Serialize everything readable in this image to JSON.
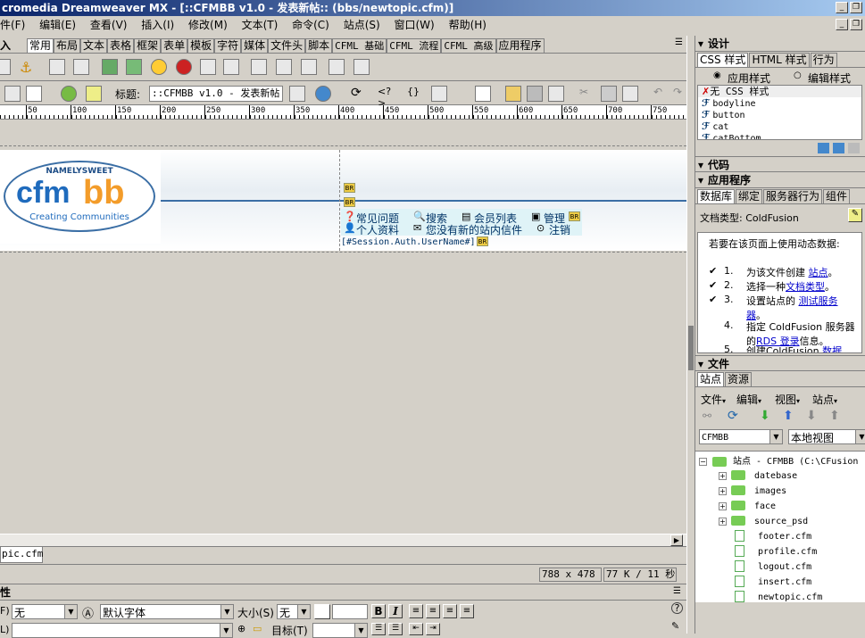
{
  "title": "cromedia Dreamweaver MX - [::CFMBB v1.0 - 发表新帖:: (bbs/newtopic.cfm)]",
  "menu": [
    "件(F)",
    "编辑(E)",
    "查看(V)",
    "插入(I)",
    "修改(M)",
    "文本(T)",
    "命令(C)",
    "站点(S)",
    "窗口(W)",
    "帮助(H)"
  ],
  "insert_label": "入",
  "insert_tabs": [
    "常用",
    "布局",
    "文本",
    "表格",
    "框架",
    "表单",
    "模板",
    "字符",
    "媒体",
    "文件头",
    "脚本",
    "CFML 基础",
    "CFML 流程",
    "CFML 高级",
    "应用程序"
  ],
  "doc_toolbar": {
    "title_label": "标题:",
    "title_value": "::CFMBB v1.0 - 发表新帖::"
  },
  "ruler_labels": [
    "50",
    "100",
    "150",
    "200",
    "250",
    "300",
    "350",
    "400",
    "450",
    "500",
    "550",
    "600",
    "650",
    "700",
    "750"
  ],
  "logo": {
    "top": "NAMELYSWEET",
    "left": "cfm",
    "right": "bb",
    "tag": "Creating Communities"
  },
  "nav": {
    "row1": [
      "常见问题",
      "搜索",
      "会员列表",
      "管理"
    ],
    "row2": [
      "个人资料",
      "您没有新的站内信件",
      "注销"
    ],
    "session": "[#Session.Auth.UserName#]"
  },
  "br_label": "BR",
  "doc_tab": "pic.cfm",
  "status": {
    "size": "788 x 478",
    "weight": "77 K / 11 秒"
  },
  "properties": {
    "title": "性",
    "format_label": "F)",
    "format_value": "无",
    "font_value": "默认字体",
    "size_label": "大小(S)",
    "size_value": "无",
    "link_label": "L)",
    "target_label": "目标(T)",
    "b": "B",
    "i": "I"
  },
  "design_panel": {
    "title": "设计",
    "tabs": [
      "CSS 样式",
      "HTML 样式",
      "行为"
    ],
    "radio1": "应用样式",
    "radio2": "编辑样式",
    "styles": [
      "无 CSS 样式",
      "bodyline",
      "button",
      "cat",
      "catBottom"
    ]
  },
  "code_panel": {
    "title": "代码"
  },
  "app_panel": {
    "title": "应用程序",
    "tabs": [
      "数据库",
      "绑定",
      "服务器行为",
      "组件"
    ],
    "doc_type": "文档类型: ColdFusion",
    "intro": "若要在该页面上使用动态数据:",
    "steps": [
      {
        "num": "1.",
        "text": "为该文件创建",
        "link": "站点",
        "tail": "。",
        "checked": true
      },
      {
        "num": "2.",
        "text": "选择一种",
        "link": "文档类型",
        "tail": "。",
        "checked": true
      },
      {
        "num": "3.",
        "text": "设置站点的",
        "link": "测试服务器",
        "tail": "。",
        "checked": true
      },
      {
        "num": "4.",
        "text": "指定 ColdFusion 服务器的",
        "link": "RDS 登录",
        "tail": "信息。",
        "checked": false
      },
      {
        "num": "5.",
        "text": "创建ColdFusion",
        "link": "数据",
        "tail": "",
        "checked": false
      }
    ]
  },
  "files_panel": {
    "title": "文件",
    "tabs": [
      "站点",
      "资源"
    ],
    "menus": [
      "文件",
      "编辑",
      "视图",
      "站点"
    ],
    "site": "CFMBB",
    "view": "本地视图",
    "root": "站点 - CFMBB (C:\\CFusion",
    "folders": [
      "datebase",
      "images",
      "face",
      "source_psd"
    ],
    "files": [
      "footer.cfm",
      "profile.cfm",
      "logout.cfm",
      "insert.cfm",
      "newtopic.cfm"
    ]
  }
}
